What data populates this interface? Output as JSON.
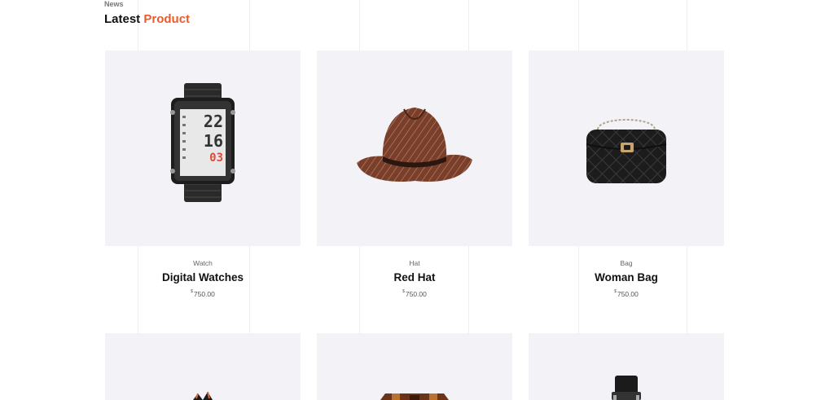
{
  "section": {
    "tag": "News",
    "title_plain": "Latest ",
    "title_accent": "Product"
  },
  "products": [
    {
      "category": "Watch",
      "name": "Digital Watches",
      "currency": "$",
      "price": "750.00",
      "image": "digital-watch",
      "display_top": "22",
      "display_mid": "16",
      "display_bottom": "03"
    },
    {
      "category": "Hat",
      "name": "Red Hat",
      "currency": "$",
      "price": "750.00",
      "image": "striped-hat"
    },
    {
      "category": "Bag",
      "name": "Woman Bag",
      "currency": "$",
      "price": "750.00",
      "image": "quilted-handbag"
    }
  ],
  "next_row": [
    {
      "image": "high-heels"
    },
    {
      "image": "leather-bag"
    },
    {
      "image": "wrist-watch"
    }
  ],
  "colors": {
    "accent": "#ee5a2c",
    "card_background": "#f3f3f7"
  }
}
